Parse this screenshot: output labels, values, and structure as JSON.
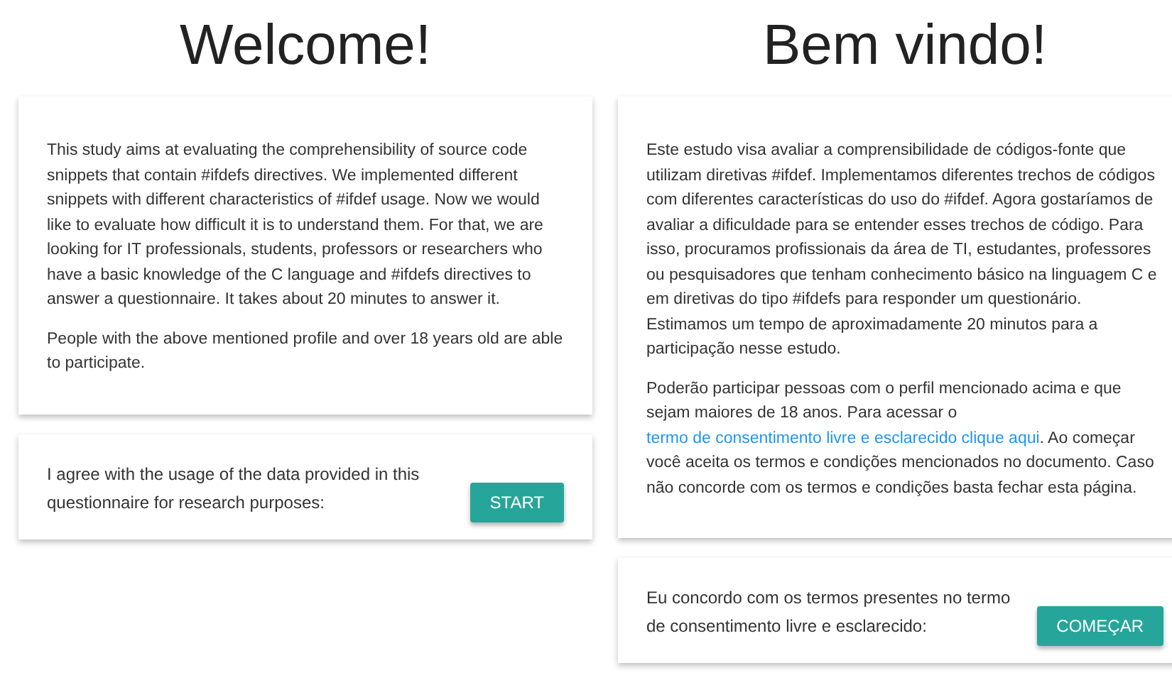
{
  "panels": [
    {
      "heading": "Welcome!",
      "paragraphs": [
        [
          {
            "kind": "text",
            "text": "This study aims at evaluating the comprehensibility of source code snippets that contain #ifdefs directives. We implemented different snippets with different characteristics of #ifdef usage. Now we would like to evaluate how difficult it is to understand them. For that, we are looking for IT professionals, students, professors or researchers who have a basic knowledge of the C language and #ifdefs directives to answer a questionnaire. It takes about 20 minutes to answer it."
          }
        ],
        [
          {
            "kind": "text",
            "text": "People with the above mentioned profile and over 18 years old are able to participate."
          }
        ]
      ],
      "consent": {
        "text": "I agree with the usage of the data provided in this questionnaire for research purposes:",
        "button": "START"
      }
    },
    {
      "heading": "Bem vindo!",
      "paragraphs": [
        [
          {
            "kind": "text",
            "text": "Este estudo visa avaliar a comprensibilidade de códigos-fonte que utilizam diretivas #ifdef. Implementamos diferentes trechos de códigos com diferentes características do uso do #ifdef. Agora gostaríamos de avaliar a dificuldade para se entender esses trechos de código. Para isso, procuramos profissionais da área de TI, estudantes, professores ou pesquisadores que tenham conhecimento básico na linguagem C e em diretivas do tipo #ifdefs para responder um questionário. Estimamos um tempo de aproximadamente 20 minutos para a participação nesse estudo."
          }
        ],
        [
          {
            "kind": "text",
            "text": "Poderão participar pessoas com o perfil mencionado acima e que sejam maiores de 18 anos. Para acessar o "
          },
          {
            "kind": "link",
            "text": "termo de consentimento livre e esclarecido clique aqui"
          },
          {
            "kind": "text",
            "text": ". Ao começar você aceita os termos e condições mencionados no documento. Caso não concorde com os termos e condições basta fechar esta página."
          }
        ]
      ],
      "consent": {
        "text": "Eu concordo com os termos presentes no termo de consentimento livre e esclarecido:",
        "button": "COMEÇAR"
      }
    }
  ]
}
